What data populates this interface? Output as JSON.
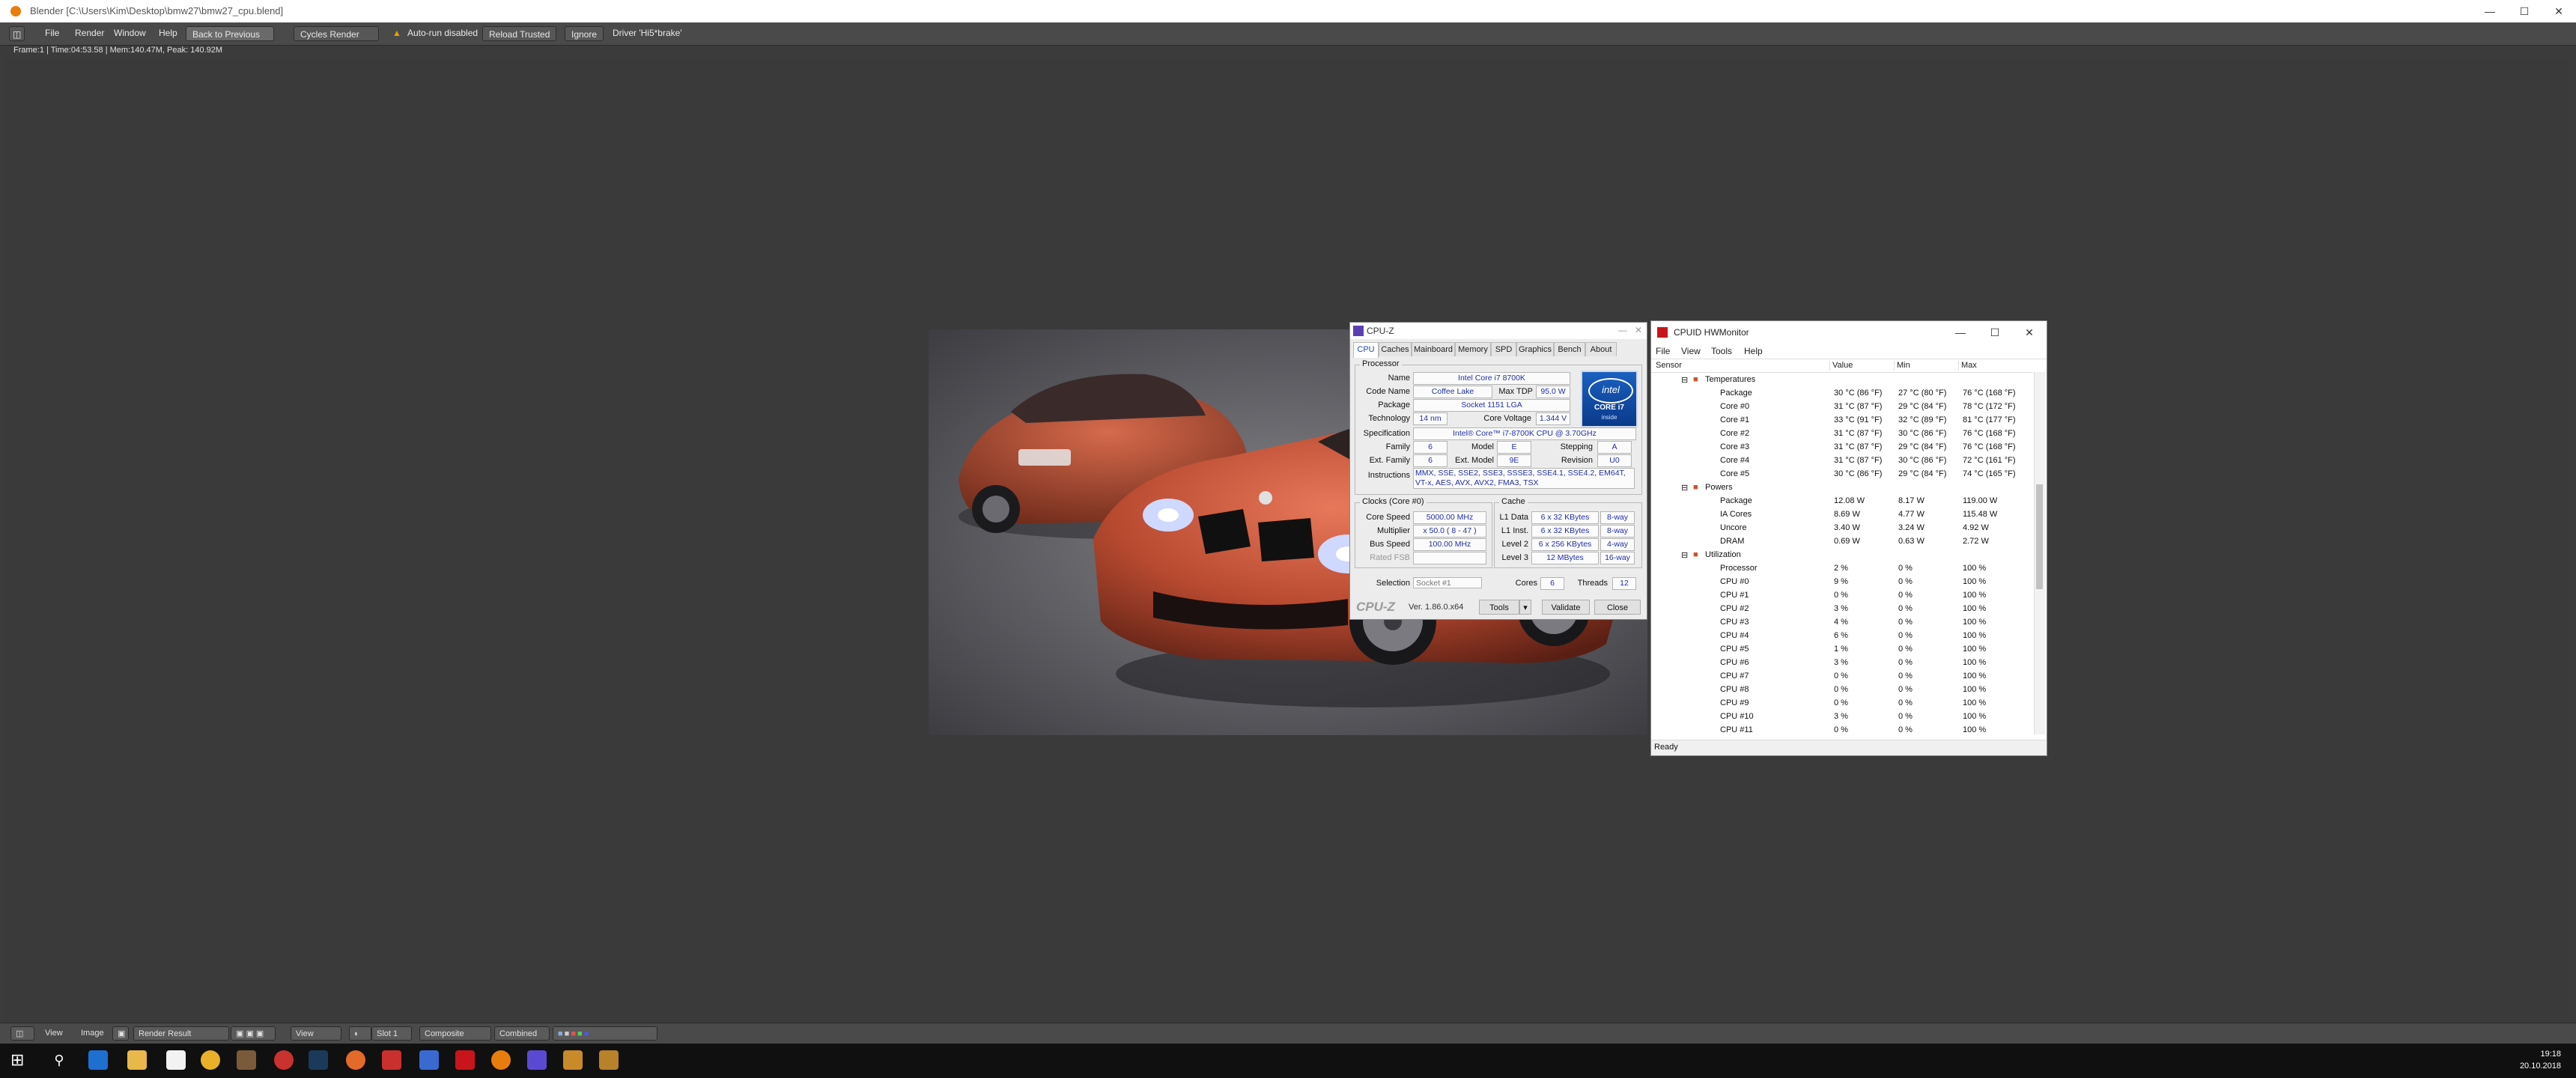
{
  "blender": {
    "title": "Blender [C:\\Users\\Kim\\Desktop\\bmw27\\bmw27_cpu.blend]",
    "menu": [
      "File",
      "Render",
      "Window",
      "Help"
    ],
    "back_button": "Back to Previous",
    "render_engine": "Cycles Render",
    "autorun_warning": "Auto-run disabled",
    "reload_trusted": "Reload Trusted",
    "ignore": "Ignore",
    "driver_text": "Driver 'Hi5*brake'",
    "info_line": "Frame:1 | Time:04:53.58 | Mem:140.47M, Peak: 140.92M",
    "bottom_bar": {
      "view": "View",
      "image": "Image",
      "image_name": "Render Result",
      "view2": "View",
      "slot": "Slot 1",
      "composite": "Composite",
      "combined": "Combined"
    }
  },
  "cpuz": {
    "title": "CPU-Z",
    "tabs": [
      "CPU",
      "Caches",
      "Mainboard",
      "Memory",
      "SPD",
      "Graphics",
      "Bench",
      "About"
    ],
    "processor_group": "Processor",
    "labels": {
      "name": "Name",
      "code_name": "Code Name",
      "max_tdp": "Max TDP",
      "package": "Package",
      "technology": "Technology",
      "core_voltage": "Core Voltage",
      "specification": "Specification",
      "family": "Family",
      "model": "Model",
      "stepping": "Stepping",
      "ext_family": "Ext. Family",
      "ext_model": "Ext. Model",
      "revision": "Revision",
      "instructions": "Instructions",
      "clocks_group": "Clocks (Core #0)",
      "core_speed": "Core Speed",
      "multiplier": "Multiplier",
      "bus_speed": "Bus Speed",
      "rated_fsb": "Rated FSB",
      "cache_group": "Cache",
      "l1_data": "L1 Data",
      "l1_inst": "L1 Inst.",
      "level2": "Level 2",
      "level3": "Level 3",
      "selection": "Selection",
      "cores": "Cores",
      "threads": "Threads"
    },
    "values": {
      "name": "Intel Core i7 8700K",
      "code_name": "Coffee Lake",
      "max_tdp": "95.0 W",
      "package": "Socket 1151 LGA",
      "technology": "14 nm",
      "core_voltage": "1.344 V",
      "specification": "Intel® Core™ i7-8700K CPU @ 3.70GHz",
      "family": "6",
      "model": "E",
      "stepping": "A",
      "ext_family": "6",
      "ext_model": "9E",
      "revision": "U0",
      "instructions": "MMX, SSE, SSE2, SSE3, SSSE3, SSE4.1, SSE4.2, EM64T, VT-x, AES, AVX, AVX2, FMA3, TSX",
      "core_speed": "5000.00 MHz",
      "multiplier": "x 50.0 ( 8 - 47 )",
      "bus_speed": "100.00 MHz",
      "l1_data": "6 x 32 KBytes",
      "l1_data_way": "8-way",
      "l1_inst": "6 x 32 KBytes",
      "l1_inst_way": "8-way",
      "level2": "6 x 256 KBytes",
      "level2_way": "4-way",
      "level3": "12 MBytes",
      "level3_way": "16-way",
      "selection": "Socket #1",
      "cores": "6",
      "threads": "12"
    },
    "logo_text": "CPU-Z",
    "version": "Ver. 1.86.0.x64",
    "tools_button": "Tools",
    "validate_button": "Validate",
    "close_button": "Close",
    "intel_badge": {
      "brand": "intel",
      "line1": "CORE i7",
      "line2": "inside"
    }
  },
  "hwmonitor": {
    "title": "CPUID HWMonitor",
    "menu": [
      "File",
      "View",
      "Tools",
      "Help"
    ],
    "columns": [
      "Sensor",
      "Value",
      "Min",
      "Max"
    ],
    "rows": [
      {
        "kind": "group",
        "name": "Temperatures"
      },
      {
        "kind": "item",
        "name": "Package",
        "value": "30 °C  (86 °F)",
        "min": "27 °C  (80 °F)",
        "max": "76 °C  (168 °F)"
      },
      {
        "kind": "item",
        "name": "Core #0",
        "value": "31 °C  (87 °F)",
        "min": "29 °C  (84 °F)",
        "max": "78 °C  (172 °F)"
      },
      {
        "kind": "item",
        "name": "Core #1",
        "value": "33 °C  (91 °F)",
        "min": "32 °C  (89 °F)",
        "max": "81 °C  (177 °F)"
      },
      {
        "kind": "item",
        "name": "Core #2",
        "value": "31 °C  (87 °F)",
        "min": "30 °C  (86 °F)",
        "max": "76 °C  (168 °F)"
      },
      {
        "kind": "item",
        "name": "Core #3",
        "value": "31 °C  (87 °F)",
        "min": "29 °C  (84 °F)",
        "max": "76 °C  (168 °F)"
      },
      {
        "kind": "item",
        "name": "Core #4",
        "value": "31 °C  (87 °F)",
        "min": "30 °C  (86 °F)",
        "max": "72 °C  (161 °F)"
      },
      {
        "kind": "item",
        "name": "Core #5",
        "value": "30 °C  (86 °F)",
        "min": "29 °C  (84 °F)",
        "max": "74 °C  (165 °F)"
      },
      {
        "kind": "group",
        "name": "Powers"
      },
      {
        "kind": "item",
        "name": "Package",
        "value": "12.08 W",
        "min": "8.17 W",
        "max": "119.00 W"
      },
      {
        "kind": "item",
        "name": "IA Cores",
        "value": "8.69 W",
        "min": "4.77 W",
        "max": "115.48 W"
      },
      {
        "kind": "item",
        "name": "Uncore",
        "value": "3.40 W",
        "min": "3.24 W",
        "max": "4.92 W"
      },
      {
        "kind": "item",
        "name": "DRAM",
        "value": "0.69 W",
        "min": "0.63 W",
        "max": "2.72 W"
      },
      {
        "kind": "group",
        "name": "Utilization"
      },
      {
        "kind": "item",
        "name": "Processor",
        "value": "2 %",
        "min": "0 %",
        "max": "100 %"
      },
      {
        "kind": "item",
        "name": "CPU #0",
        "value": "9 %",
        "min": "0 %",
        "max": "100 %"
      },
      {
        "kind": "item",
        "name": "CPU #1",
        "value": "0 %",
        "min": "0 %",
        "max": "100 %"
      },
      {
        "kind": "item",
        "name": "CPU #2",
        "value": "3 %",
        "min": "0 %",
        "max": "100 %"
      },
      {
        "kind": "item",
        "name": "CPU #3",
        "value": "4 %",
        "min": "0 %",
        "max": "100 %"
      },
      {
        "kind": "item",
        "name": "CPU #4",
        "value": "6 %",
        "min": "0 %",
        "max": "100 %"
      },
      {
        "kind": "item",
        "name": "CPU #5",
        "value": "1 %",
        "min": "0 %",
        "max": "100 %"
      },
      {
        "kind": "item",
        "name": "CPU #6",
        "value": "3 %",
        "min": "0 %",
        "max": "100 %"
      },
      {
        "kind": "item",
        "name": "CPU #7",
        "value": "0 %",
        "min": "0 %",
        "max": "100 %"
      },
      {
        "kind": "item",
        "name": "CPU #8",
        "value": "0 %",
        "min": "0 %",
        "max": "100 %"
      },
      {
        "kind": "item",
        "name": "CPU #9",
        "value": "0 %",
        "min": "0 %",
        "max": "100 %"
      },
      {
        "kind": "item",
        "name": "CPU #10",
        "value": "3 %",
        "min": "0 %",
        "max": "100 %"
      },
      {
        "kind": "item",
        "name": "CPU #11",
        "value": "0 %",
        "min": "0 %",
        "max": "100 %"
      }
    ],
    "status": "Ready"
  },
  "taskbar": {
    "time": "19:18",
    "date": "20.10.2018"
  },
  "colors": {
    "blender_bg": "#3b3b3b",
    "cpuz_value_text": "#1f2fa8",
    "car_paint": "#c8563a"
  }
}
